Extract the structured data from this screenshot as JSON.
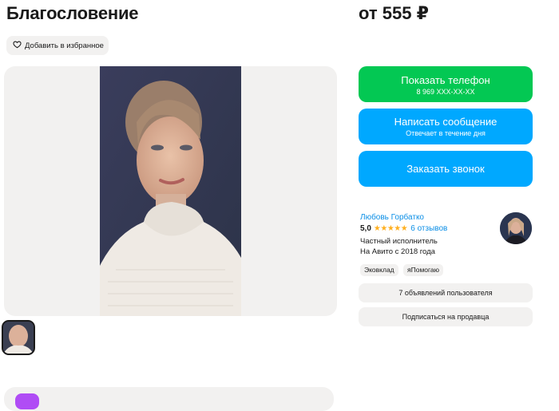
{
  "listing": {
    "title": "Благословение",
    "price": "от 555 ₽",
    "favorite_label": "Добавить в избранное"
  },
  "contact": {
    "phone_label": "Показать телефон",
    "phone_masked": "8 969 XXX-XX-XX",
    "message_label": "Написать сообщение",
    "message_sub": "Отвечает в течение дня",
    "call_label": "Заказать звонок"
  },
  "seller": {
    "name": "Любовь Горбатко",
    "rating": "5,0",
    "stars": "★★★★★",
    "reviews": "6 отзывов",
    "type": "Частный исполнитель",
    "since": "На Авито с 2018 года",
    "badges": [
      "Эковклад",
      "яПомогаю"
    ],
    "listings_button": "7 объявлений пользователя",
    "subscribe_button": "Подписаться на продавца"
  },
  "colors": {
    "green": "#03c853",
    "blue": "#00a8ff",
    "link": "#0a8ee6",
    "star": "#ffb021",
    "panel": "#f2f1f0"
  }
}
